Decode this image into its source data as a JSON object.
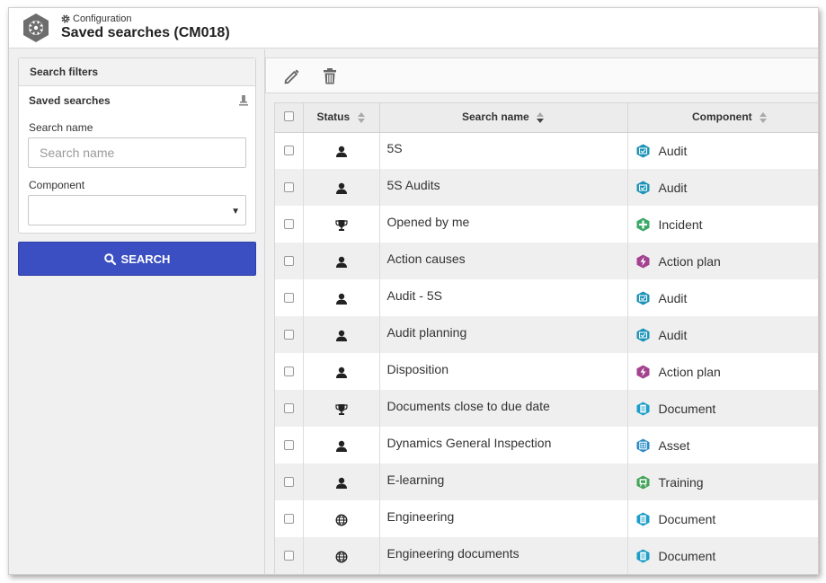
{
  "header": {
    "breadcrumb": "Configuration",
    "title": "Saved searches (CM018)"
  },
  "filters": {
    "panel_title": "Search filters",
    "section_title": "Saved searches",
    "search_name_label": "Search name",
    "search_name_placeholder": "Search name",
    "search_name_value": "",
    "component_label": "Component",
    "component_value": "",
    "search_button": "SEARCH"
  },
  "toolbar": {
    "edit_icon": "pencil-icon",
    "delete_icon": "trash-icon"
  },
  "grid": {
    "columns": [
      "Status",
      "Search name",
      "Component"
    ],
    "rows": [
      {
        "status": "user",
        "name": "5S",
        "component": "Audit",
        "comp_icon": "audit"
      },
      {
        "status": "user",
        "name": "5S Audits",
        "component": "Audit",
        "comp_icon": "audit"
      },
      {
        "status": "trophy",
        "name": "Opened by me",
        "component": "Incident",
        "comp_icon": "incident"
      },
      {
        "status": "user",
        "name": "Action causes",
        "component": "Action plan",
        "comp_icon": "action"
      },
      {
        "status": "user",
        "name": "Audit - 5S",
        "component": "Audit",
        "comp_icon": "audit"
      },
      {
        "status": "user",
        "name": "Audit planning",
        "component": "Audit",
        "comp_icon": "audit"
      },
      {
        "status": "user",
        "name": "Disposition",
        "component": "Action plan",
        "comp_icon": "action"
      },
      {
        "status": "trophy",
        "name": "Documents close to due date",
        "component": "Document",
        "comp_icon": "document"
      },
      {
        "status": "user",
        "name": "Dynamics General Inspection",
        "component": "Asset",
        "comp_icon": "asset"
      },
      {
        "status": "user",
        "name": "E-learning",
        "component": "Training",
        "comp_icon": "training"
      },
      {
        "status": "globe",
        "name": "Engineering",
        "component": "Document",
        "comp_icon": "document"
      },
      {
        "status": "globe",
        "name": "Engineering documents",
        "component": "Document",
        "comp_icon": "document"
      }
    ]
  },
  "colors": {
    "accent_button": "#3c4fc2",
    "audit": "#1a93b8",
    "incident": "#3aa866",
    "action": "#a3428f",
    "document": "#1d9ec9",
    "asset": "#2b8bc7",
    "training": "#45a35a"
  }
}
